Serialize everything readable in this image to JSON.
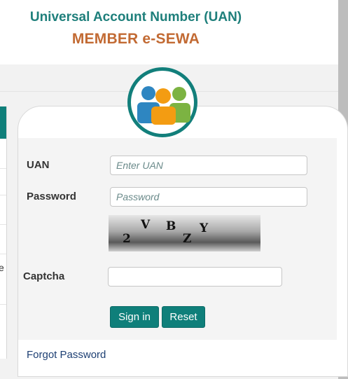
{
  "header": {
    "title": "Universal Account Number (UAN)",
    "subtitle": "MEMBER e-SEWA"
  },
  "login": {
    "uan_label": "UAN",
    "uan_placeholder": "Enter UAN",
    "password_label": "Password",
    "password_placeholder": "Password",
    "captcha_label": "Captcha",
    "captcha_text": [
      "2",
      "V",
      "B",
      "Z",
      "Y"
    ],
    "signin_label": "Sign in",
    "reset_label": "Reset",
    "forgot_label": "Forgot Password"
  },
  "left_panel": {
    "partial_letter": "e"
  },
  "colors": {
    "teal": "#0f7f7a",
    "title": "#1e7f7b",
    "subtitle": "#c26a33",
    "link": "#1d3f73",
    "logo_blue": "#2e86c1",
    "logo_orange": "#f39c12",
    "logo_green": "#7cb342"
  },
  "icons": {
    "logo": "group-of-people-icon"
  }
}
